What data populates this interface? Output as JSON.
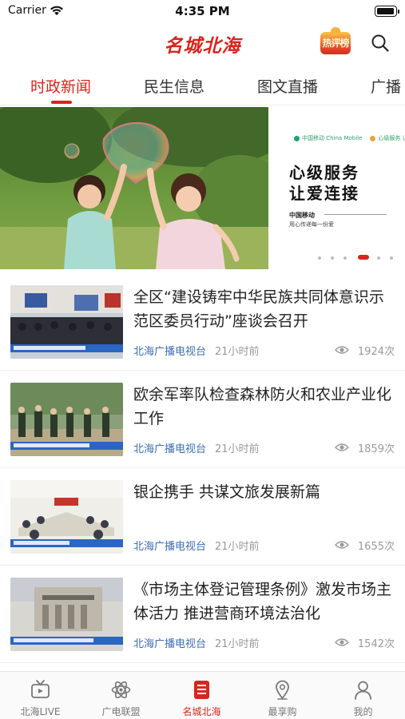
{
  "status_bar": {
    "carrier": "Carrier",
    "time": "4:35 PM"
  },
  "header": {
    "logo": "名城北海",
    "hot_badge": "热评榜"
  },
  "tabs": [
    {
      "label": "时政新闻",
      "active": true
    },
    {
      "label": "民生信息"
    },
    {
      "label": "图文直播"
    },
    {
      "label": "广播"
    }
  ],
  "banner": {
    "logo_left": "中国移动 China Mobile",
    "logo_right": "心级服务 让爱连接",
    "title_line1": "心级服务",
    "title_line2": "让爱连接",
    "brand": "中国移动",
    "slogan": "用心传递每一份爱",
    "slides_total": 6,
    "active_slide": 4
  },
  "news": [
    {
      "title": "全区“建设铸牢中华民族共同体意识示范区委员行动”座谈会召开",
      "source": "北海广播电视台",
      "time": "21小时前",
      "views": "1924次"
    },
    {
      "title": "欧余军率队检查森林防火和农业产业化工作",
      "source": "北海广播电视台",
      "time": "21小时前",
      "views": "1859次"
    },
    {
      "title": "银企携手 共谋文旅发展新篇",
      "source": "北海广播电视台",
      "time": "21小时前",
      "views": "1655次"
    },
    {
      "title": "《市场主体登记管理条例》激发市场主体活力 推进营商环境法治化",
      "source": "北海广播电视台",
      "time": "21小时前",
      "views": "1542次"
    }
  ],
  "bottom_nav": [
    {
      "label": "北海LIVE",
      "icon": "tv-icon"
    },
    {
      "label": "广电联盟",
      "icon": "atom-icon"
    },
    {
      "label": "名城北海",
      "icon": "news-list-icon",
      "active": true
    },
    {
      "label": "最享购",
      "icon": "location-pin-icon"
    },
    {
      "label": "我的",
      "icon": "user-icon"
    }
  ],
  "colors": {
    "accent": "#d9251c",
    "source_blue": "#3c6cb4",
    "muted": "#999999"
  }
}
